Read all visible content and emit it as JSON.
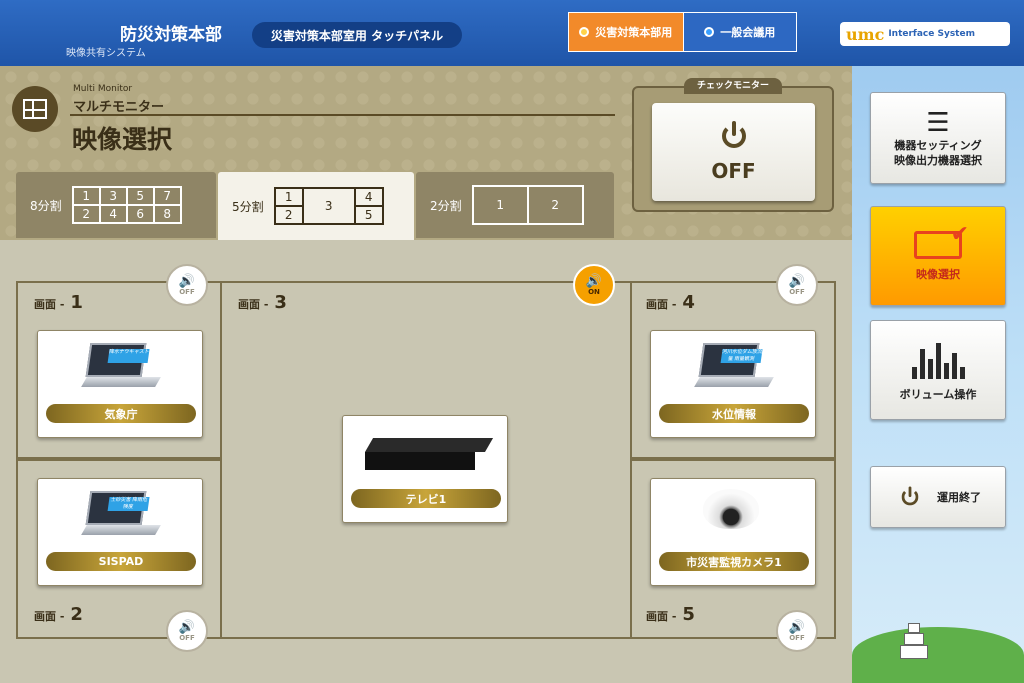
{
  "header": {
    "title": "防災対策本部",
    "subtitle": "映像共有システム",
    "panel_label": "災害対策本部室用 タッチパネル",
    "modes": [
      {
        "label": "災害対策本部用",
        "active": true
      },
      {
        "label": "一般会議用",
        "active": false
      }
    ],
    "brand_mark": "umc",
    "brand_text": "Interface System"
  },
  "section": {
    "en": "Multi Monitor",
    "jp": "マルチモニター",
    "title": "映像選択"
  },
  "check_monitor": {
    "label": "チェックモニター",
    "status": "OFF"
  },
  "split_tabs": [
    {
      "label": "8分割",
      "cells": [
        "1",
        "3",
        "5",
        "7",
        "2",
        "4",
        "6",
        "8"
      ],
      "selected": false
    },
    {
      "label": "5分割",
      "cells": [
        "1",
        "3",
        "4",
        "2",
        "5"
      ],
      "selected": true
    },
    {
      "label": "2分割",
      "cells": [
        "1",
        "2"
      ],
      "selected": false
    }
  ],
  "screens": [
    {
      "prefix": "画面 -",
      "num": "1",
      "source": "気象庁",
      "screen_text": "降水ナウキャスト",
      "audio": "OFF"
    },
    {
      "prefix": "画面 -",
      "num": "2",
      "source": "SISPAD",
      "screen_text": "土砂災害 降雨危険度",
      "audio": "OFF"
    },
    {
      "prefix": "画面 -",
      "num": "3",
      "source": "テレビ1",
      "audio": "ON"
    },
    {
      "prefix": "画面 -",
      "num": "4",
      "source": "水位情報",
      "screen_text": "河川水位ダム放流量 雨量観測",
      "audio": "OFF"
    },
    {
      "prefix": "画面 -",
      "num": "5",
      "source": "市災害監視カメラ1",
      "audio": "OFF"
    }
  ],
  "sidebar": {
    "items": [
      {
        "label": "機器セッティング\n映像出力機器選択",
        "icon": "settings-list-icon"
      },
      {
        "label": "映像選択",
        "icon": "monitor-check-icon",
        "active": true
      },
      {
        "label": "ボリューム操作",
        "icon": "volume-bars-icon"
      },
      {
        "label": "運用終了",
        "icon": "power-icon"
      }
    ]
  },
  "colors": {
    "header": "#2f6cc4",
    "accent_orange": "#f28a2a",
    "gold": "#c8a53a",
    "active_button": "#ffb000"
  }
}
